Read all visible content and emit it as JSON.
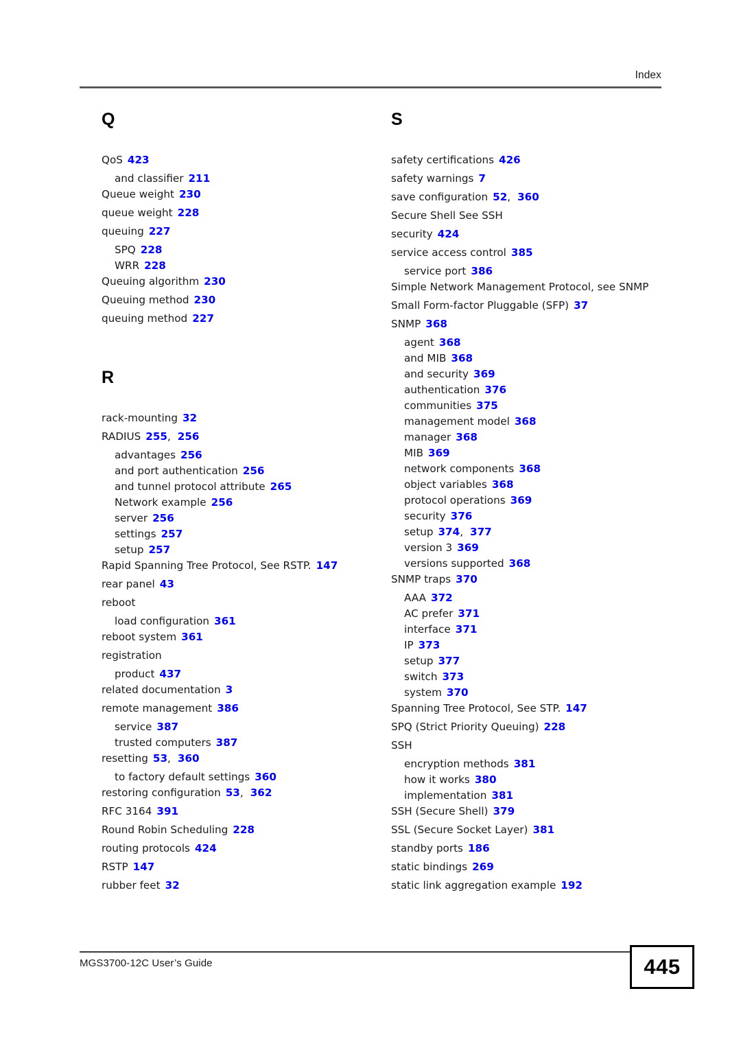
{
  "header": {
    "label": "Index"
  },
  "footer": {
    "document_title": "MGS3700-12C User’s Guide",
    "page_number": "445"
  },
  "columns": [
    {
      "name": "left-column",
      "sections": [
        {
          "letter": "Q",
          "first": true,
          "entries": [
            {
              "level": 0,
              "term": "QoS",
              "pages": [
                "423"
              ]
            },
            {
              "level": 1,
              "term": "and classifier",
              "pages": [
                "211"
              ]
            },
            {
              "level": 0,
              "term": "Queue weight",
              "pages": [
                "230"
              ]
            },
            {
              "level": 0,
              "term": "queue weight",
              "pages": [
                "228"
              ]
            },
            {
              "level": 0,
              "term": "queuing",
              "pages": [
                "227"
              ]
            },
            {
              "level": 1,
              "term": "SPQ",
              "pages": [
                "228"
              ]
            },
            {
              "level": 1,
              "term": "WRR",
              "pages": [
                "228"
              ]
            },
            {
              "level": 0,
              "term": "Queuing algorithm",
              "pages": [
                "230"
              ]
            },
            {
              "level": 0,
              "term": "Queuing method",
              "pages": [
                "230"
              ]
            },
            {
              "level": 0,
              "term": "queuing method",
              "pages": [
                "227"
              ]
            }
          ]
        },
        {
          "letter": "R",
          "first": false,
          "entries": [
            {
              "level": 0,
              "term": "rack-mounting",
              "pages": [
                "32"
              ]
            },
            {
              "level": 0,
              "term": "RADIUS",
              "pages": [
                "255",
                "256"
              ]
            },
            {
              "level": 1,
              "term": "advantages",
              "pages": [
                "256"
              ]
            },
            {
              "level": 1,
              "term": "and port authentication",
              "pages": [
                "256"
              ]
            },
            {
              "level": 1,
              "term": "and tunnel protocol attribute",
              "pages": [
                "265"
              ]
            },
            {
              "level": 1,
              "term": "Network example",
              "pages": [
                "256"
              ]
            },
            {
              "level": 1,
              "term": "server",
              "pages": [
                "256"
              ]
            },
            {
              "level": 1,
              "term": "settings",
              "pages": [
                "257"
              ]
            },
            {
              "level": 1,
              "term": "setup",
              "pages": [
                "257"
              ]
            },
            {
              "level": 0,
              "term": "Rapid Spanning Tree Protocol, See RSTP.",
              "pages": [
                "147"
              ]
            },
            {
              "level": 0,
              "term": "rear panel",
              "pages": [
                "43"
              ]
            },
            {
              "level": 0,
              "term": "reboot",
              "pages": []
            },
            {
              "level": 1,
              "term": "load configuration",
              "pages": [
                "361"
              ]
            },
            {
              "level": 0,
              "term": "reboot system",
              "pages": [
                "361"
              ]
            },
            {
              "level": 0,
              "term": "registration",
              "pages": []
            },
            {
              "level": 1,
              "term": "product",
              "pages": [
                "437"
              ]
            },
            {
              "level": 0,
              "term": "related documentation",
              "pages": [
                "3"
              ]
            },
            {
              "level": 0,
              "term": "remote management",
              "pages": [
                "386"
              ]
            },
            {
              "level": 1,
              "term": "service",
              "pages": [
                "387"
              ]
            },
            {
              "level": 1,
              "term": "trusted computers",
              "pages": [
                "387"
              ]
            },
            {
              "level": 0,
              "term": "resetting",
              "pages": [
                "53",
                "360"
              ]
            },
            {
              "level": 1,
              "term": "to factory default settings",
              "pages": [
                "360"
              ]
            },
            {
              "level": 0,
              "term": "restoring configuration",
              "pages": [
                "53",
                "362"
              ]
            },
            {
              "level": 0,
              "term": "RFC 3164",
              "pages": [
                "391"
              ]
            },
            {
              "level": 0,
              "term": "Round Robin Scheduling",
              "pages": [
                "228"
              ]
            },
            {
              "level": 0,
              "term": "routing protocols",
              "pages": [
                "424"
              ]
            },
            {
              "level": 0,
              "term": "RSTP",
              "pages": [
                "147"
              ]
            },
            {
              "level": 0,
              "term": "rubber feet",
              "pages": [
                "32"
              ]
            }
          ]
        }
      ]
    },
    {
      "name": "right-column",
      "sections": [
        {
          "letter": "S",
          "first": true,
          "entries": [
            {
              "level": 0,
              "term": "safety certifications",
              "pages": [
                "426"
              ]
            },
            {
              "level": 0,
              "term": "safety warnings",
              "pages": [
                "7"
              ]
            },
            {
              "level": 0,
              "term": "save configuration",
              "pages": [
                "52",
                "360"
              ]
            },
            {
              "level": 0,
              "term": "Secure Shell See SSH",
              "pages": []
            },
            {
              "level": 0,
              "term": "security",
              "pages": [
                "424"
              ]
            },
            {
              "level": 0,
              "term": "service access control",
              "pages": [
                "385"
              ]
            },
            {
              "level": 1,
              "term": "service port",
              "pages": [
                "386"
              ]
            },
            {
              "level": 0,
              "term": "Simple Network Management Protocol, see SNMP",
              "pages": []
            },
            {
              "level": 0,
              "term": "Small Form-factor Pluggable (SFP)",
              "pages": [
                "37"
              ]
            },
            {
              "level": 0,
              "term": "SNMP",
              "pages": [
                "368"
              ]
            },
            {
              "level": 1,
              "term": "agent",
              "pages": [
                "368"
              ]
            },
            {
              "level": 1,
              "term": "and MIB",
              "pages": [
                "368"
              ]
            },
            {
              "level": 1,
              "term": "and security",
              "pages": [
                "369"
              ]
            },
            {
              "level": 1,
              "term": "authentication",
              "pages": [
                "376"
              ]
            },
            {
              "level": 1,
              "term": "communities",
              "pages": [
                "375"
              ]
            },
            {
              "level": 1,
              "term": "management model",
              "pages": [
                "368"
              ]
            },
            {
              "level": 1,
              "term": "manager",
              "pages": [
                "368"
              ]
            },
            {
              "level": 1,
              "term": "MIB",
              "pages": [
                "369"
              ]
            },
            {
              "level": 1,
              "term": "network components",
              "pages": [
                "368"
              ]
            },
            {
              "level": 1,
              "term": "object variables",
              "pages": [
                "368"
              ]
            },
            {
              "level": 1,
              "term": "protocol operations",
              "pages": [
                "369"
              ]
            },
            {
              "level": 1,
              "term": "security",
              "pages": [
                "376"
              ]
            },
            {
              "level": 1,
              "term": "setup",
              "pages": [
                "374",
                "377"
              ]
            },
            {
              "level": 1,
              "term": "version 3",
              "pages": [
                "369"
              ]
            },
            {
              "level": 1,
              "term": "versions supported",
              "pages": [
                "368"
              ]
            },
            {
              "level": 0,
              "term": "SNMP traps",
              "pages": [
                "370"
              ]
            },
            {
              "level": 1,
              "term": "AAA",
              "pages": [
                "372"
              ]
            },
            {
              "level": 1,
              "term": "AC prefer",
              "pages": [
                "371"
              ]
            },
            {
              "level": 1,
              "term": "interface",
              "pages": [
                "371"
              ]
            },
            {
              "level": 1,
              "term": "IP",
              "pages": [
                "373"
              ]
            },
            {
              "level": 1,
              "term": "setup",
              "pages": [
                "377"
              ]
            },
            {
              "level": 1,
              "term": "switch",
              "pages": [
                "373"
              ]
            },
            {
              "level": 1,
              "term": "system",
              "pages": [
                "370"
              ]
            },
            {
              "level": 0,
              "term": "Spanning Tree Protocol, See STP.",
              "pages": [
                "147"
              ]
            },
            {
              "level": 0,
              "term": "SPQ (Strict Priority Queuing)",
              "pages": [
                "228"
              ]
            },
            {
              "level": 0,
              "term": "SSH",
              "pages": []
            },
            {
              "level": 1,
              "term": "encryption methods",
              "pages": [
                "381"
              ]
            },
            {
              "level": 1,
              "term": "how it works",
              "pages": [
                "380"
              ]
            },
            {
              "level": 1,
              "term": "implementation",
              "pages": [
                "381"
              ]
            },
            {
              "level": 0,
              "term": "SSH (Secure Shell)",
              "pages": [
                "379"
              ]
            },
            {
              "level": 0,
              "term": "SSL (Secure Socket Layer)",
              "pages": [
                "381"
              ]
            },
            {
              "level": 0,
              "term": "standby ports",
              "pages": [
                "186"
              ]
            },
            {
              "level": 0,
              "term": "static bindings",
              "pages": [
                "269"
              ]
            },
            {
              "level": 0,
              "term": "static link aggregation example",
              "pages": [
                "192"
              ]
            }
          ]
        }
      ]
    }
  ],
  "colors": {
    "page_number_link": "#0000ff",
    "text": "#1a1a1a",
    "rule": "#4a4a4a"
  }
}
